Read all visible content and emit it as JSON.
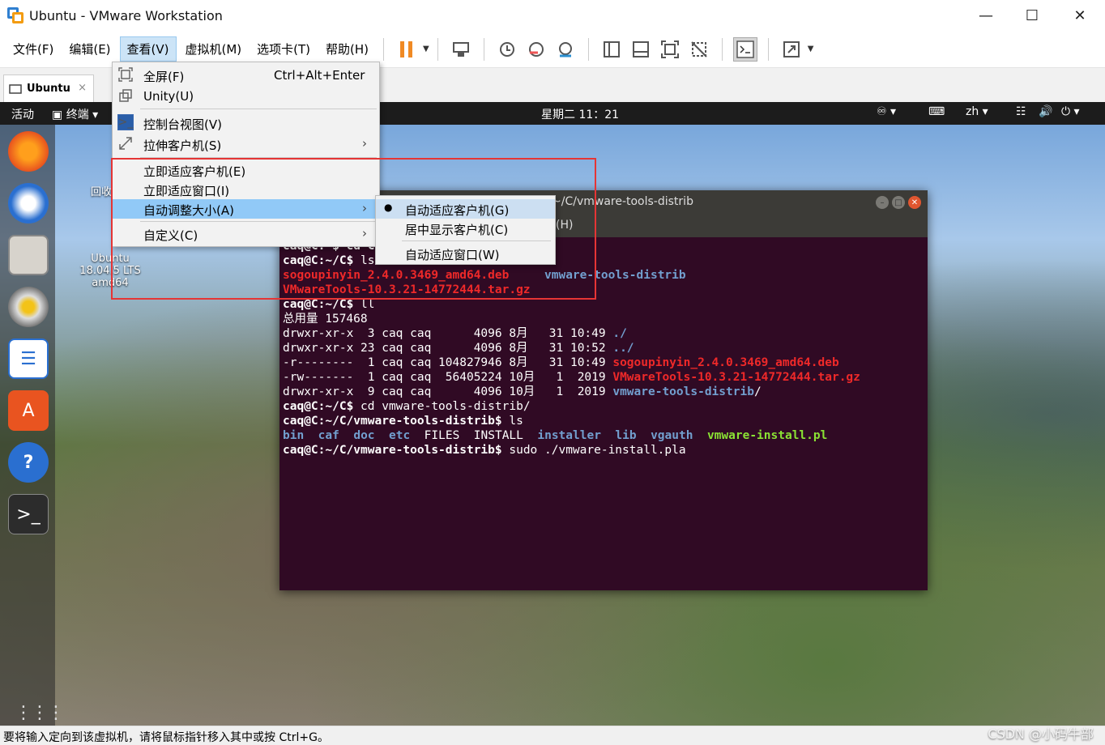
{
  "window": {
    "title": "Ubuntu - VMware Workstation"
  },
  "menubar": {
    "items": [
      {
        "label": "文件(F)"
      },
      {
        "label": "编辑(E)"
      },
      {
        "label": "查看(V)"
      },
      {
        "label": "虚拟机(M)"
      },
      {
        "label": "选项卡(T)"
      },
      {
        "label": "帮助(H)"
      }
    ]
  },
  "tab": {
    "label": "Ubuntu",
    "close": "×"
  },
  "view_menu": {
    "items": [
      {
        "label": "全屏(F)",
        "shortcut": "Ctrl+Alt+Enter"
      },
      {
        "label": "Unity(U)"
      },
      {
        "label": "控制台视图(V)"
      },
      {
        "label": "拉伸客户机(S)"
      },
      {
        "label": "立即适应客户机(E)"
      },
      {
        "label": "立即适应窗口(I)"
      },
      {
        "label": "自动调整大小(A)"
      },
      {
        "label": "自定义(C)"
      }
    ]
  },
  "autosize_submenu": {
    "items": [
      {
        "label": "自动适应客户机(G)",
        "checked": true
      },
      {
        "label": "居中显示客户机(C)"
      },
      {
        "label": "自动适应窗口(W)"
      }
    ]
  },
  "guest": {
    "topbar": {
      "activities": "活动",
      "app": "终端",
      "clock": "星期二 11：21",
      "lang": "zh"
    },
    "desktop_labels": {
      "trash": "回收",
      "dvd": "Ubuntu\n18.04.5 LTS\namd64"
    },
    "terminal": {
      "title": "~/C/vmware-tools-distrib",
      "menu_help": "(H)",
      "lines": [
        {
          "parts": [
            {
              "t": "caq@C:~$ cd C",
              "c": "ps"
            }
          ]
        },
        {
          "parts": [
            {
              "t": "caq@C:~/C$ ",
              "c": "ps"
            },
            {
              "t": "ls",
              "c": ""
            }
          ]
        },
        {
          "parts": [
            {
              "t": "sogoupinyin_2.4.0.3469_amd64.deb",
              "c": "red"
            },
            {
              "t": "     ",
              "c": ""
            },
            {
              "t": "vmware-tools-distrib",
              "c": "blue"
            }
          ]
        },
        {
          "parts": [
            {
              "t": "VMwareTools-10.3.21-14772444.tar.gz",
              "c": "red"
            }
          ]
        },
        {
          "parts": [
            {
              "t": "caq@C:~/C$ ",
              "c": "ps"
            },
            {
              "t": "ll",
              "c": ""
            }
          ]
        },
        {
          "parts": [
            {
              "t": "总用量 157468",
              "c": ""
            }
          ]
        },
        {
          "parts": [
            {
              "t": "drwxr-xr-x  3 caq caq      4096 8月   31 10:49 ",
              "c": ""
            },
            {
              "t": "./",
              "c": "blue"
            }
          ]
        },
        {
          "parts": [
            {
              "t": "drwxr-xr-x 23 caq caq      4096 8月   31 10:52 ",
              "c": ""
            },
            {
              "t": "../",
              "c": "blue"
            }
          ]
        },
        {
          "parts": [
            {
              "t": "-r--------  1 caq caq 104827946 8月   31 10:49 ",
              "c": ""
            },
            {
              "t": "sogoupinyin_2.4.0.3469_amd64.deb",
              "c": "red"
            }
          ]
        },
        {
          "parts": [
            {
              "t": "-rw-------  1 caq caq  56405224 10月   1  2019 ",
              "c": ""
            },
            {
              "t": "VMwareTools-10.3.21-14772444.tar.gz",
              "c": "red"
            }
          ]
        },
        {
          "parts": [
            {
              "t": "drwxr-xr-x  9 caq caq      4096 10月   1  2019 ",
              "c": ""
            },
            {
              "t": "vmware-tools-distrib",
              "c": "blue"
            },
            {
              "t": "/",
              "c": ""
            }
          ]
        },
        {
          "parts": [
            {
              "t": "caq@C:~/C$ ",
              "c": "ps"
            },
            {
              "t": "cd vmware-tools-distrib/",
              "c": ""
            }
          ]
        },
        {
          "parts": [
            {
              "t": "caq@C:~/C/vmware-tools-distrib$ ",
              "c": "ps"
            },
            {
              "t": "ls",
              "c": ""
            }
          ]
        },
        {
          "parts": [
            {
              "t": "bin",
              "c": "blue"
            },
            {
              "t": "  ",
              "c": ""
            },
            {
              "t": "caf",
              "c": "blue"
            },
            {
              "t": "  ",
              "c": ""
            },
            {
              "t": "doc",
              "c": "blue"
            },
            {
              "t": "  ",
              "c": ""
            },
            {
              "t": "etc",
              "c": "blue"
            },
            {
              "t": "  FILES  INSTALL  ",
              "c": ""
            },
            {
              "t": "installer",
              "c": "blue"
            },
            {
              "t": "  ",
              "c": ""
            },
            {
              "t": "lib",
              "c": "blue"
            },
            {
              "t": "  ",
              "c": ""
            },
            {
              "t": "vgauth",
              "c": "blue"
            },
            {
              "t": "  ",
              "c": ""
            },
            {
              "t": "vmware-install.pl",
              "c": "green"
            }
          ]
        },
        {
          "parts": [
            {
              "t": "caq@C:~/C/vmware-tools-distrib$ ",
              "c": "ps"
            },
            {
              "t": "sudo ./vmware-install.pla",
              "c": ""
            }
          ]
        }
      ]
    }
  },
  "statusbar": {
    "text": "要将输入定向到该虚拟机，请将鼠标指针移入其中或按 Ctrl+G。"
  },
  "watermark": "CSDN @小码牛部"
}
